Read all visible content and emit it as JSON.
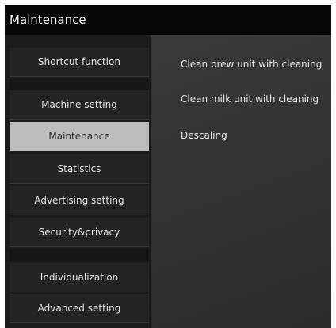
{
  "window": {
    "title": "Maintenance"
  },
  "sidebar": {
    "items": [
      {
        "label": "Shortcut function"
      },
      {
        "label": "Machine setting"
      },
      {
        "label": "Maintenance",
        "selected": true
      },
      {
        "label": "Statistics"
      },
      {
        "label": "Advertising setting"
      },
      {
        "label": "Security&privacy"
      },
      {
        "label": "Individualization"
      },
      {
        "label": "Advanced setting"
      }
    ]
  },
  "main": {
    "options": [
      {
        "label": "Clean brew unit with cleaning"
      },
      {
        "label": "Clean milk unit with cleaning"
      },
      {
        "label": "Descaling"
      }
    ]
  },
  "colors": {
    "titlebar_bg": "#050505",
    "content_bg": "#353535",
    "sidebar_bg": "#1b1b1b",
    "selected_bg": "#bdbdbd",
    "text": "#e6e6e6"
  }
}
